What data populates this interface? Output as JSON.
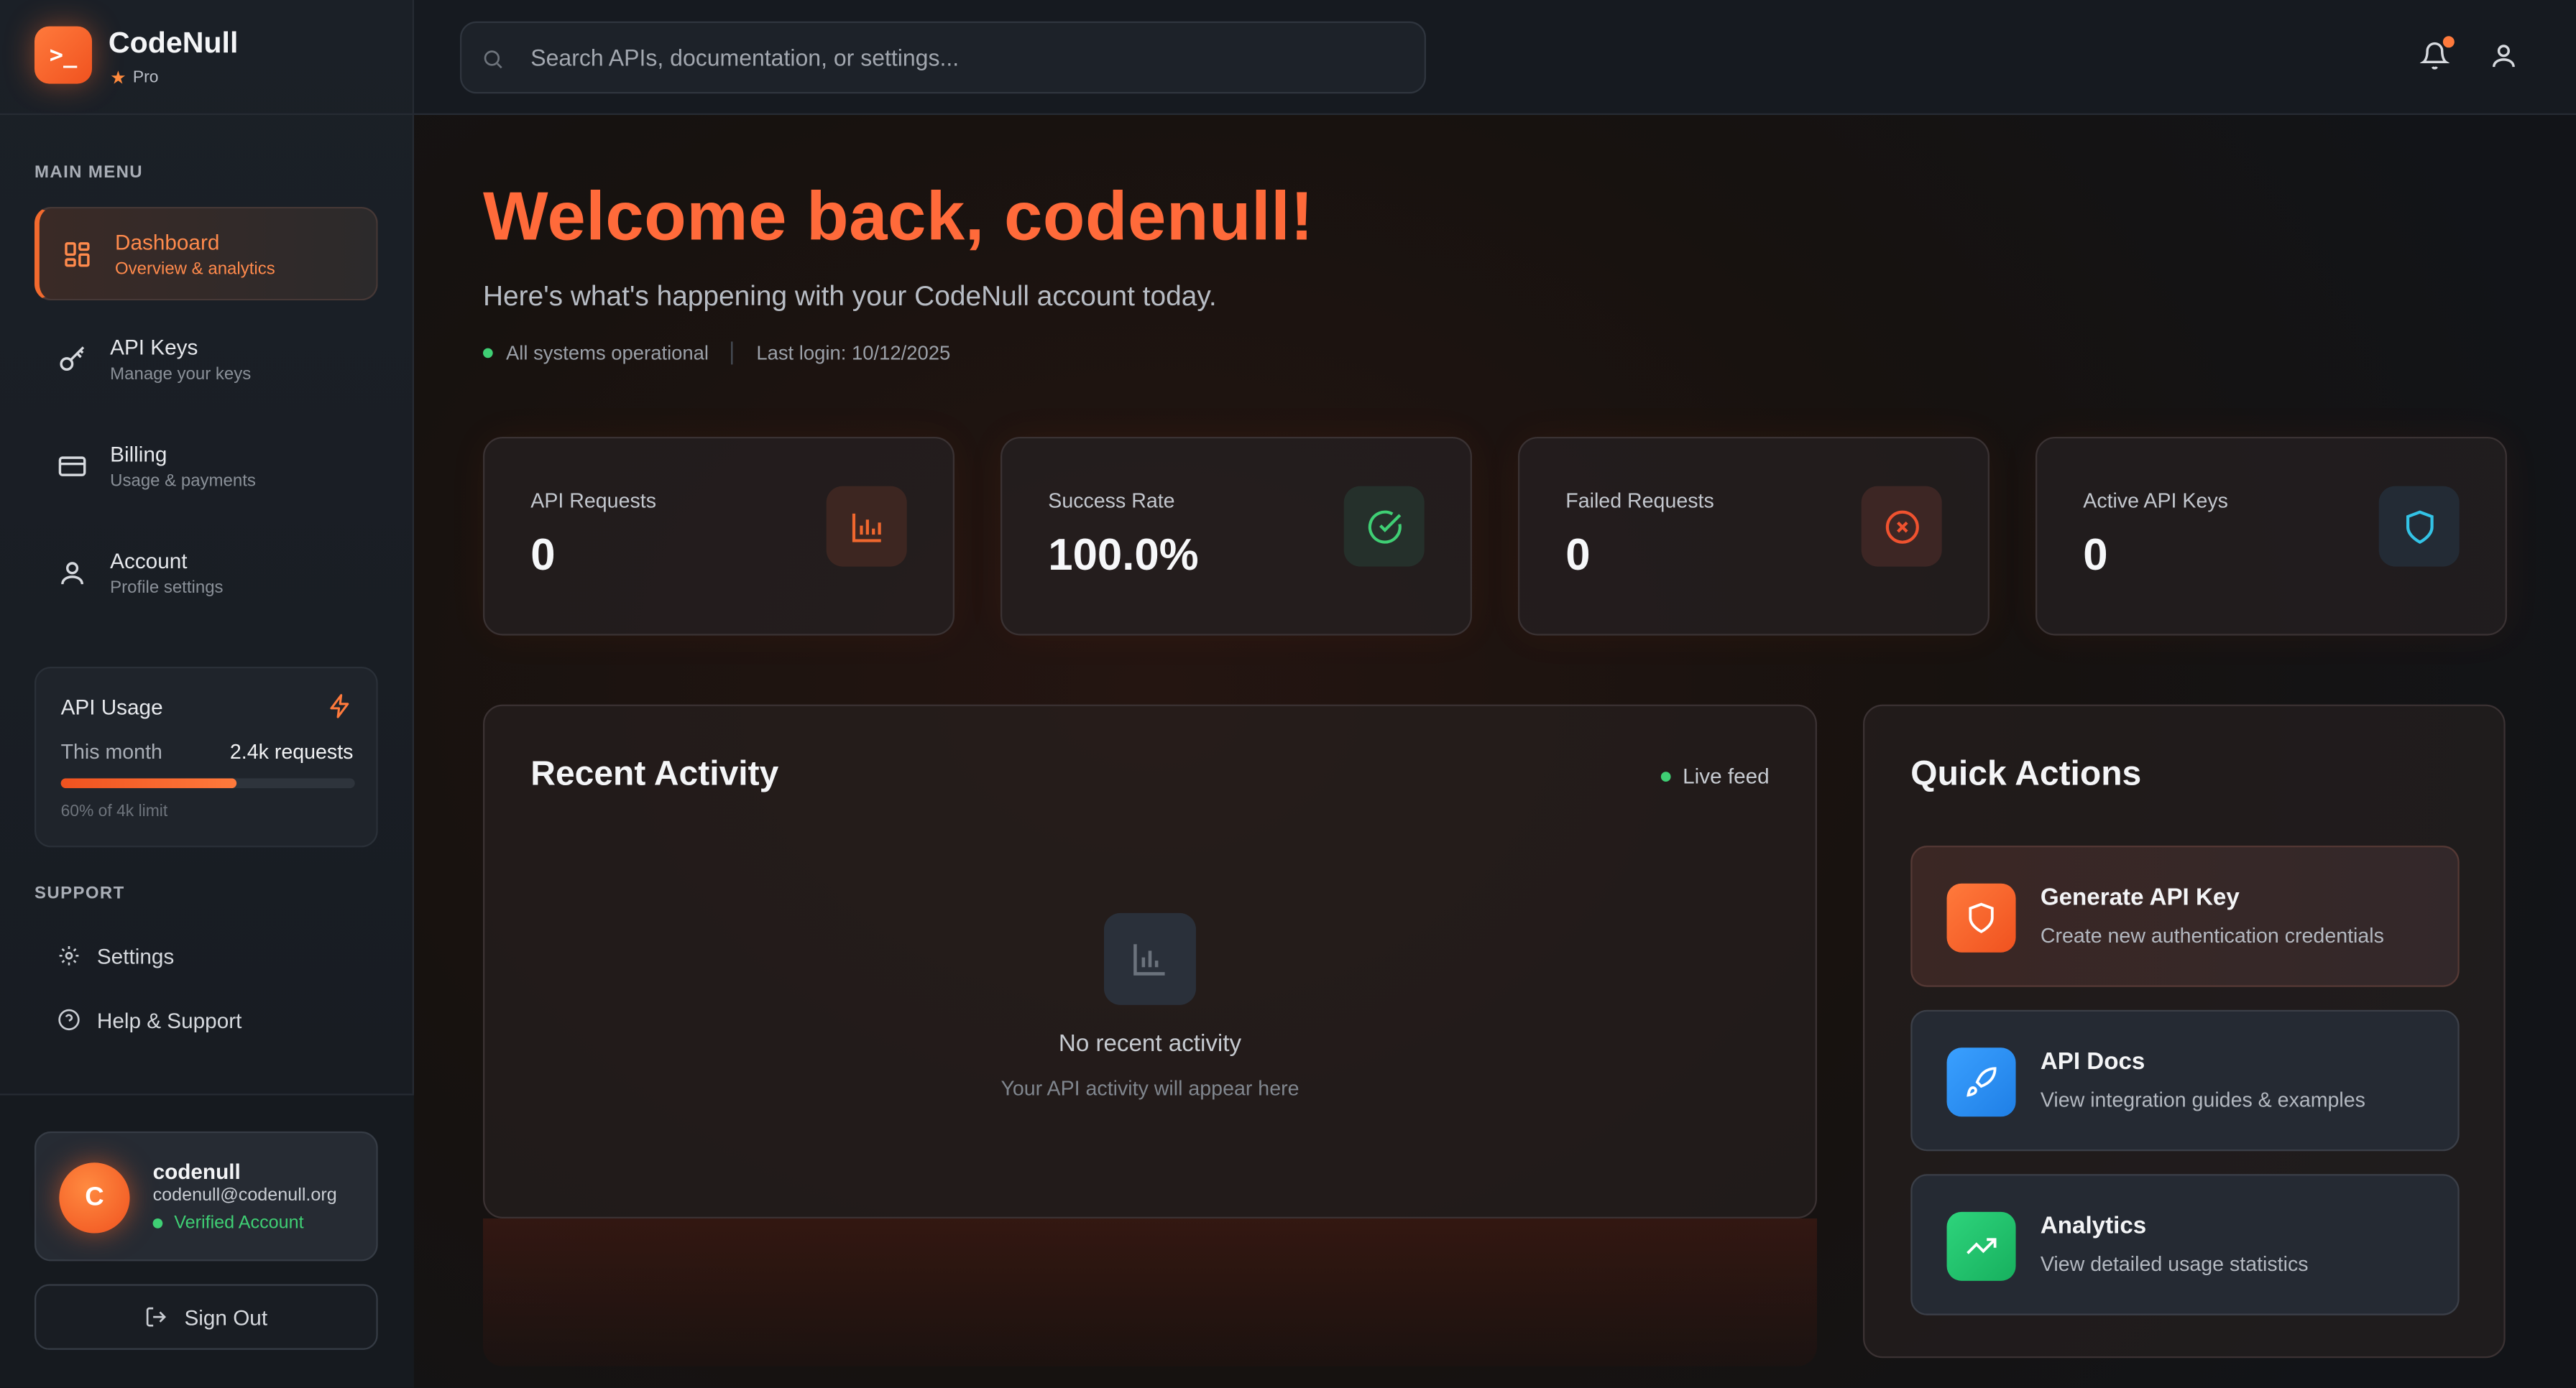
{
  "brand": {
    "name": "CodeNull",
    "plan": "Pro",
    "logo_glyph": ">_"
  },
  "sidebar": {
    "main_menu_label": "MAIN MENU",
    "items": [
      {
        "title": "Dashboard",
        "subtitle": "Overview & analytics",
        "icon": "dashboard-grid-icon",
        "active": true
      },
      {
        "title": "API Keys",
        "subtitle": "Manage your keys",
        "icon": "key-icon",
        "active": false
      },
      {
        "title": "Billing",
        "subtitle": "Usage & payments",
        "icon": "credit-card-icon",
        "active": false
      },
      {
        "title": "Account",
        "subtitle": "Profile settings",
        "icon": "user-icon",
        "active": false
      }
    ],
    "usage": {
      "title": "API Usage",
      "period_label": "This month",
      "requests": "2.4k requests",
      "limit_text": "60% of 4k limit",
      "progress_percent": 60
    },
    "support_label": "SUPPORT",
    "support_items": [
      {
        "label": "Settings",
        "icon": "gear-icon"
      },
      {
        "label": "Help & Support",
        "icon": "help-circle-icon"
      }
    ],
    "user": {
      "initial": "C",
      "name": "codenull",
      "email": "codenull@codenull.org",
      "status": "Verified Account"
    },
    "signout_label": "Sign Out"
  },
  "header": {
    "search_placeholder": "Search APIs, documentation, or settings..."
  },
  "main": {
    "welcome": "Welcome back, codenull!",
    "subtitle": "Here's what's happening with your CodeNull account today.",
    "system_status": "All systems operational",
    "last_login": "Last login: 10/12/2025",
    "stats": [
      {
        "label": "API Requests",
        "value": "0",
        "icon": "bar-chart-icon",
        "accent": "#f0672e"
      },
      {
        "label": "Success Rate",
        "value": "100.0%",
        "icon": "check-circle-icon",
        "accent": "#3fcf74"
      },
      {
        "label": "Failed Requests",
        "value": "0",
        "icon": "x-circle-icon",
        "accent": "#f0522f"
      },
      {
        "label": "Active API Keys",
        "value": "0",
        "icon": "shield-icon",
        "accent": "#33c3e6"
      }
    ],
    "activity": {
      "title": "Recent Activity",
      "live_label": "Live feed",
      "empty_title": "No recent activity",
      "empty_sub": "Your API activity will appear here"
    },
    "quick_actions": {
      "title": "Quick Actions",
      "items": [
        {
          "title": "Generate API Key",
          "subtitle": "Create new authentication credentials",
          "icon": "shield-icon",
          "color": "#f0521f"
        },
        {
          "title": "API Docs",
          "subtitle": "View integration guides & examples",
          "icon": "rocket-icon",
          "color": "#2a8ff0"
        },
        {
          "title": "Analytics",
          "subtitle": "View detailed usage statistics",
          "icon": "trending-up-icon",
          "color": "#20c06a"
        }
      ]
    }
  },
  "colors": {
    "accent": "#ff6a3a",
    "success": "#3fcf74",
    "background": "#121519"
  }
}
